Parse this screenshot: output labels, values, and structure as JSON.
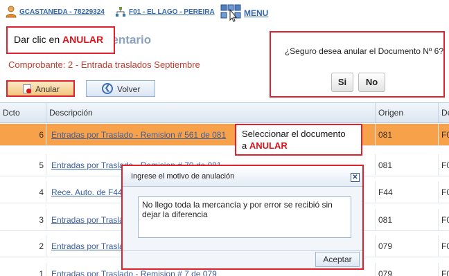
{
  "header": {
    "user": "GCASTANEDA - 78229324",
    "branch": "F01 - EL LAGO - PEREIRA",
    "menu": "MENU"
  },
  "page": {
    "title_partial": "ventario",
    "subtitle": "Comprobante: 2 - Entrada traslados Septiembre"
  },
  "callout_anular": {
    "text": "Dar clic en ",
    "highlight": "ANULAR"
  },
  "toolbar": {
    "anular_label": "Anular",
    "volver_label": "Volver"
  },
  "confirm_dialog": {
    "message": "¿Seguro desea anular el Documento Nº 6?",
    "yes_label": "Si",
    "no_label": "No"
  },
  "table": {
    "columns": [
      "Dcto",
      "Descripción",
      "Origen",
      "De"
    ],
    "rows": [
      {
        "dcto": "6",
        "desc": "Entradas por Traslado - Remision # 561 de 081",
        "origen": "081",
        "dest": "F0",
        "selected": true
      },
      {
        "dcto": "5",
        "desc": "Entradas por Traslado - Remision # 70 de 081",
        "origen": "081",
        "dest": "F0"
      },
      {
        "dcto": "4",
        "desc": "Rece. Auto. de F44",
        "origen": "F44",
        "dest": "F0"
      },
      {
        "dcto": "3",
        "desc": "Entradas por Traslado",
        "origen": "081",
        "dest": "F0"
      },
      {
        "dcto": "2",
        "desc": "Entradas por Traslado",
        "origen": "079",
        "dest": "F0"
      },
      {
        "dcto": "1",
        "desc": "Entradas por Traslado - Remision # 7 de 079",
        "origen": "079",
        "dest": "F0"
      }
    ]
  },
  "callout_select": {
    "line1": "Seleccionar el documento",
    "line2_prefix": "a ",
    "highlight": "ANULAR"
  },
  "motive_dialog": {
    "title": "Ingrese el motivo de anulación",
    "text": "No llego toda la mercancía y por error se recibió sin dejar la diferencia",
    "ok_label": "Aceptar"
  },
  "colors": {
    "callout_border": "#e0202a",
    "selected_row": "#f7a24a",
    "link": "#3366aa"
  }
}
